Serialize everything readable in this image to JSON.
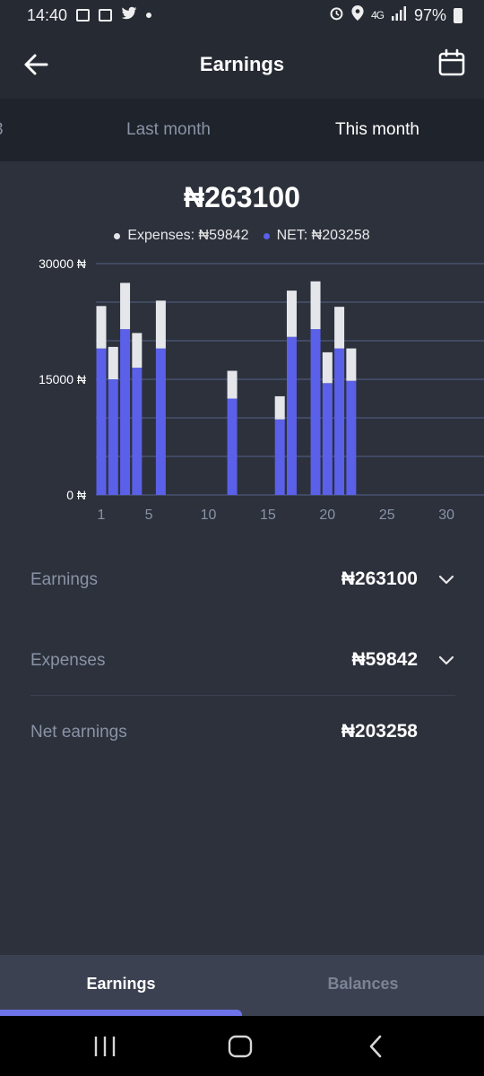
{
  "status_bar": {
    "time": "14:40",
    "network": "4G",
    "battery": "97%"
  },
  "header": {
    "title": "Earnings",
    "back_icon": "arrow-left-icon",
    "calendar_icon": "calendar-icon"
  },
  "period_tabs": {
    "partial_label": "3",
    "last_month": "Last month",
    "this_month": "This month",
    "active": "This month"
  },
  "summary": {
    "total": "₦263100",
    "legend": {
      "expenses_label": "Expenses: ₦59842",
      "net_label": "NET: ₦203258"
    }
  },
  "colors": {
    "net": "#5b60e8",
    "expenses": "#e4e6ea",
    "grid": "#4b5a79",
    "background": "#2c313c"
  },
  "chart_data": {
    "type": "bar",
    "stacked": true,
    "y_tick_labels": [
      "30000 ₦",
      "15000 ₦",
      "0 ₦"
    ],
    "x_tick_labels": [
      "1",
      "5",
      "10",
      "15",
      "20",
      "25",
      "30"
    ],
    "ylim": [
      0,
      30000
    ],
    "xlim": [
      1,
      31
    ],
    "series": [
      {
        "name": "NET",
        "color": "#5b60e8",
        "points": [
          {
            "x": 1,
            "y": 19000
          },
          {
            "x": 2,
            "y": 15000
          },
          {
            "x": 3,
            "y": 21500
          },
          {
            "x": 4,
            "y": 16500
          },
          {
            "x": 6,
            "y": 19000
          },
          {
            "x": 12,
            "y": 12500
          },
          {
            "x": 16,
            "y": 9800
          },
          {
            "x": 17,
            "y": 20500
          },
          {
            "x": 19,
            "y": 21500
          },
          {
            "x": 20,
            "y": 14500
          },
          {
            "x": 21,
            "y": 19000
          },
          {
            "x": 22,
            "y": 14800
          }
        ]
      },
      {
        "name": "Expenses",
        "color": "#e4e6ea",
        "points": [
          {
            "x": 1,
            "y": 5500
          },
          {
            "x": 2,
            "y": 4200
          },
          {
            "x": 3,
            "y": 6000
          },
          {
            "x": 4,
            "y": 4500
          },
          {
            "x": 6,
            "y": 6200
          },
          {
            "x": 12,
            "y": 3600
          },
          {
            "x": 16,
            "y": 3000
          },
          {
            "x": 17,
            "y": 6000
          },
          {
            "x": 19,
            "y": 6200
          },
          {
            "x": 20,
            "y": 4000
          },
          {
            "x": 21,
            "y": 5400
          },
          {
            "x": 22,
            "y": 4200
          }
        ]
      }
    ]
  },
  "rows": [
    {
      "label": "Earnings",
      "value": "₦263100",
      "chevron_icon": "chevron-down-icon"
    },
    {
      "label": "Expenses",
      "value": "₦59842",
      "chevron_icon": "chevron-down-icon"
    },
    {
      "label": "Net earnings",
      "value": "₦203258"
    }
  ],
  "bottom_tabs": {
    "earnings": "Earnings",
    "balances": "Balances",
    "active": "Earnings"
  },
  "system_nav": {
    "recents_icon": "recents-icon",
    "home_icon": "home-icon",
    "back_icon": "back-chevron-icon"
  }
}
